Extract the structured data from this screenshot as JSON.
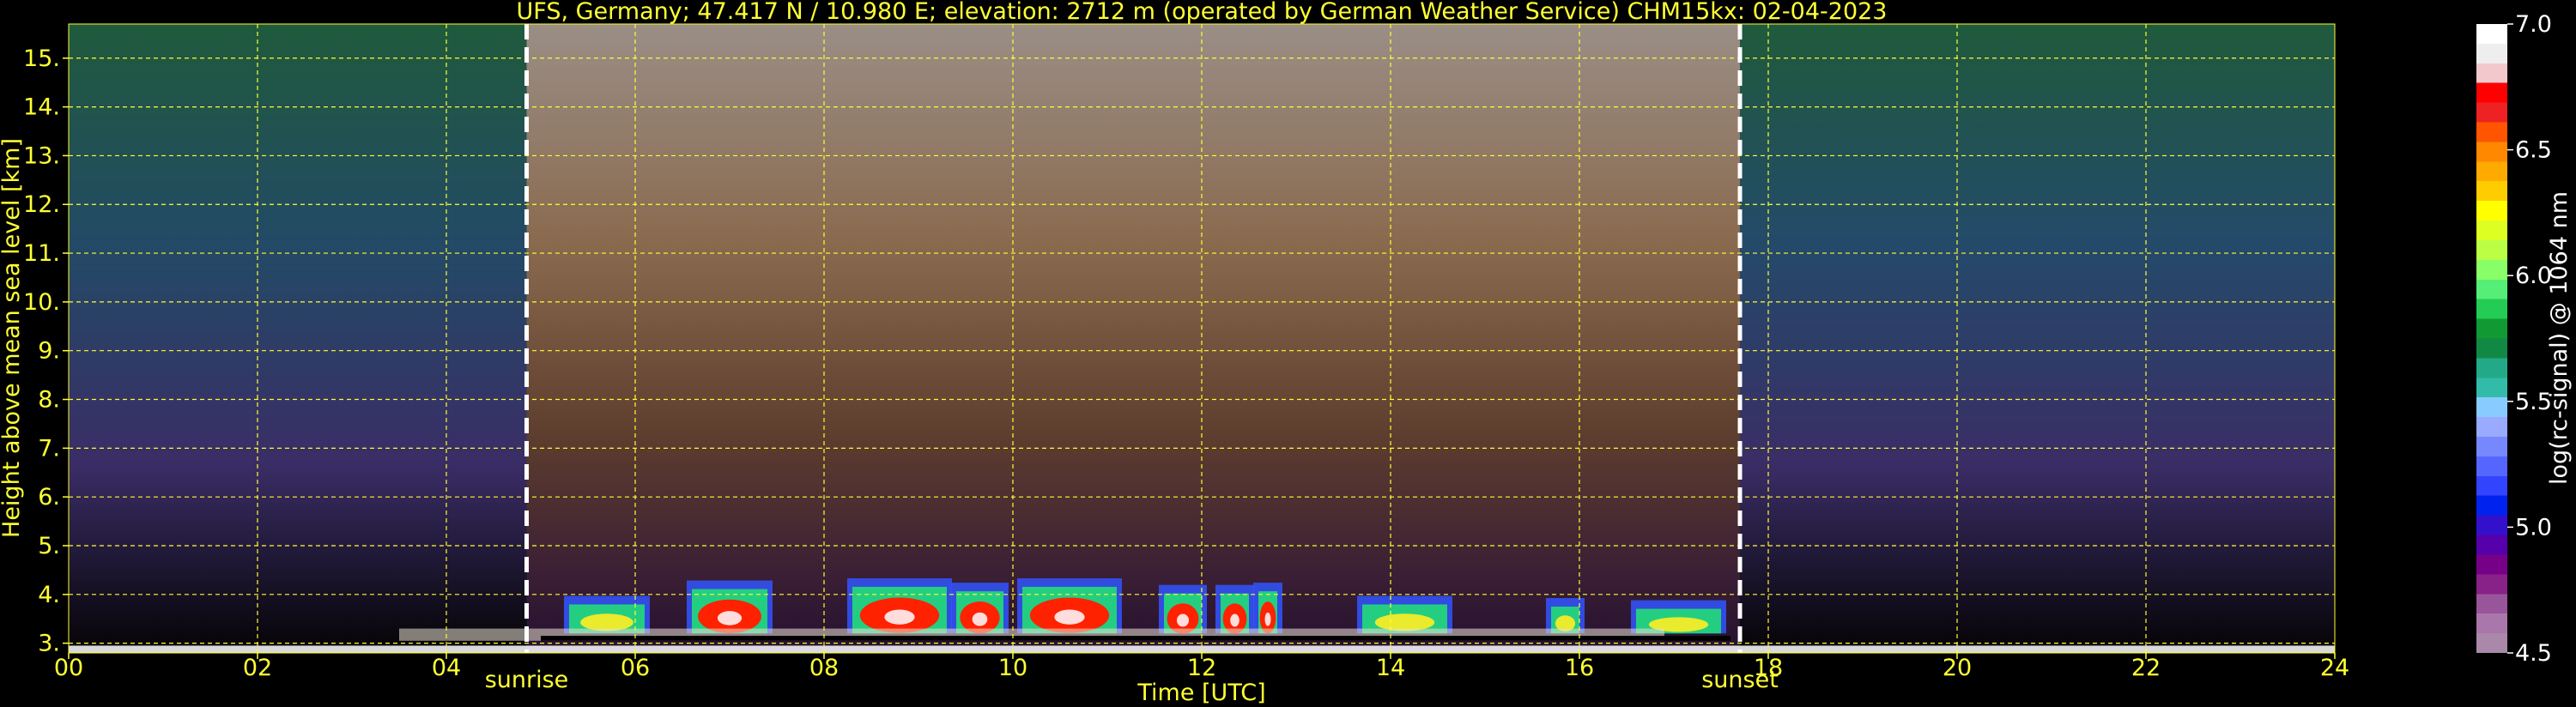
{
  "chart_data": {
    "type": "heatmap",
    "title": "UFS, Germany; 47.417 N / 10.980 E; elevation: 2712 m  (operated by German Weather Service)    CHM15kx: 02-04-2023",
    "xlabel": "Time [UTC]",
    "ylabel": "Height above mean sea level [km]",
    "xlim": [
      0,
      24
    ],
    "ylim": [
      2.8,
      15.7
    ],
    "x_ticks": [
      "00",
      "02",
      "04",
      "06",
      "08",
      "10",
      "12",
      "14",
      "16",
      "18",
      "20",
      "22",
      "24"
    ],
    "y_ticks": [
      "3.",
      "4.",
      "5.",
      "6.",
      "7.",
      "8.",
      "9.",
      "10.",
      "11.",
      "12.",
      "13.",
      "14.",
      "15."
    ],
    "grid": true,
    "annotations": [
      {
        "label": "sunrise",
        "x": 4.85
      },
      {
        "label": "sunset",
        "x": 17.7
      }
    ],
    "colorbar": {
      "label": "log(rc-signal) @ 1064 nm",
      "range": [
        4.5,
        7.0
      ],
      "ticks": [
        "7.0",
        "6.5",
        "6.0",
        "5.5",
        "5.0",
        "4.5"
      ],
      "colors": [
        "#ffffff",
        "#eeeeee",
        "#f3c8cc",
        "#ff0000",
        "#ee2222",
        "#ff5500",
        "#ff8800",
        "#ffaa00",
        "#ffcc00",
        "#ffff00",
        "#ddff22",
        "#bbff44",
        "#88ff66",
        "#55ee77",
        "#22cc55",
        "#119933",
        "#118844",
        "#22aa88",
        "#33bbaa",
        "#88ccff",
        "#99aaff",
        "#7788ff",
        "#5566ff",
        "#3344ff",
        "#0022ee",
        "#3311cc",
        "#5500aa",
        "#770088",
        "#882288",
        "#995599",
        "#aa77aa",
        "#aa88aa"
      ]
    },
    "cloud_events": [
      {
        "start": 5.3,
        "end": 6.1,
        "intensity": 0.55
      },
      {
        "start": 6.6,
        "end": 7.4,
        "intensity": 0.9
      },
      {
        "start": 8.3,
        "end": 9.3,
        "intensity": 0.95
      },
      {
        "start": 9.4,
        "end": 9.9,
        "intensity": 0.85
      },
      {
        "start": 10.1,
        "end": 11.1,
        "intensity": 0.95
      },
      {
        "start": 11.6,
        "end": 12.0,
        "intensity": 0.8
      },
      {
        "start": 12.2,
        "end": 12.5,
        "intensity": 0.8
      },
      {
        "start": 12.6,
        "end": 12.8,
        "intensity": 0.85
      },
      {
        "start": 13.7,
        "end": 14.6,
        "intensity": 0.55
      },
      {
        "start": 15.7,
        "end": 16.0,
        "intensity": 0.5
      },
      {
        "start": 16.6,
        "end": 17.5,
        "intensity": 0.45
      }
    ]
  }
}
